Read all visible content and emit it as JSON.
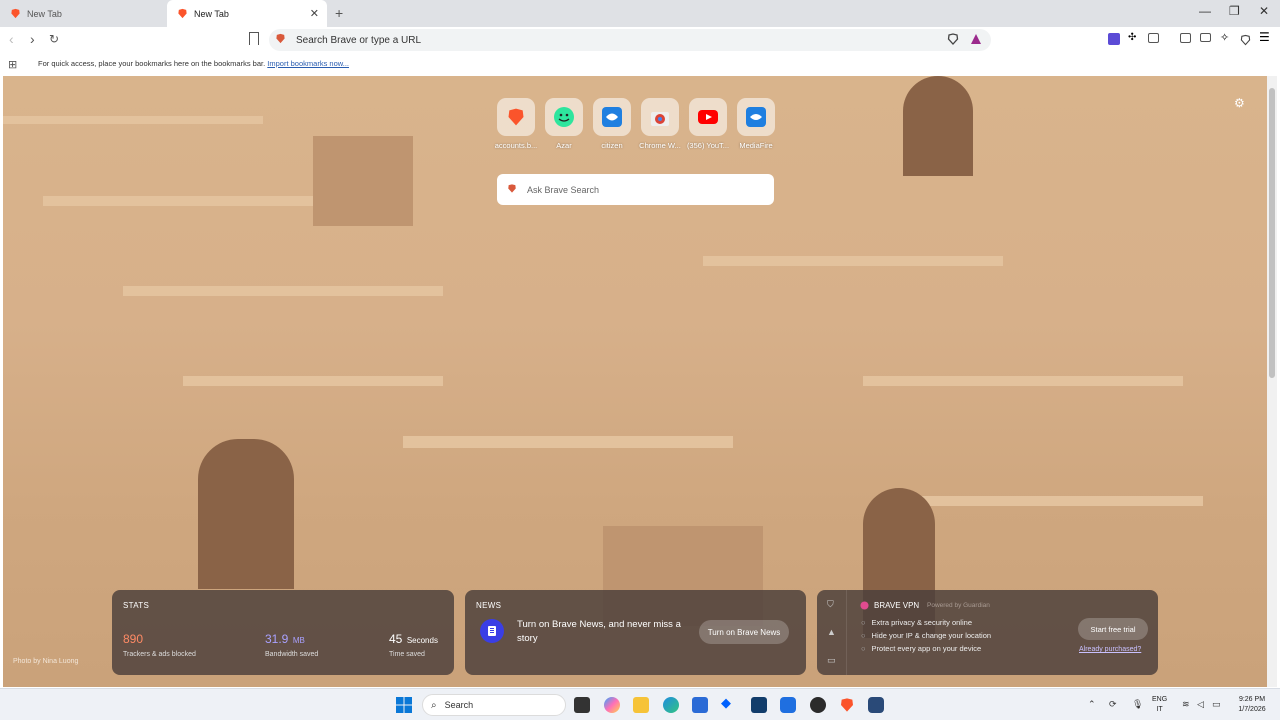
{
  "tabs": [
    {
      "title": "New Tab",
      "active": false
    },
    {
      "title": "New Tab",
      "active": true
    }
  ],
  "toolbar": {
    "address_placeholder": "Search Brave or type a URL"
  },
  "bookmarks_bar": {
    "message": "For quick access, place your bookmarks here on the bookmarks bar.",
    "import_link": "Import bookmarks now..."
  },
  "top_sites": [
    {
      "label": "accounts.b...",
      "icon": "brave-lion-icon"
    },
    {
      "label": "Azar",
      "icon": "azar-icon"
    },
    {
      "label": "citizen",
      "icon": "citizen-icon"
    },
    {
      "label": "Chrome W...",
      "icon": "chrome-web-store-icon"
    },
    {
      "label": "(356) YouT...",
      "icon": "youtube-icon"
    },
    {
      "label": "MediaFire",
      "icon": "mediafire-icon"
    }
  ],
  "search": {
    "placeholder": "Ask Brave Search"
  },
  "photo_credit": "Photo by Nina Luong",
  "stats": {
    "heading": "STATS",
    "trackers_value": "890",
    "trackers_label": "Trackers & ads blocked",
    "bandwidth_value": "31.9",
    "bandwidth_unit": "MB",
    "bandwidth_label": "Bandwidth saved",
    "time_value": "45",
    "time_unit": "Seconds",
    "time_label": "Time saved"
  },
  "news": {
    "heading": "NEWS",
    "text": "Turn on Brave News, and never miss a story",
    "button": "Turn on Brave News"
  },
  "vpn": {
    "title": "BRAVE VPN",
    "powered_by": "Powered by Guardian",
    "features": [
      "Extra privacy & security online",
      "Hide your IP & change your location",
      "Protect every app on your device"
    ],
    "trial_button": "Start free trial",
    "purchased_link": "Already purchased?"
  },
  "taskbar": {
    "search_label": "Search",
    "lang_line1": "ENG",
    "lang_line2": "IT",
    "time": "9:26 PM",
    "date": "1/7/2026"
  },
  "colors": {
    "brave_orange": "#fb542b",
    "stats_trackers": "#ff8a65",
    "stats_bandwidth": "#a9a1ff",
    "news_purple": "#3a3ee5"
  }
}
